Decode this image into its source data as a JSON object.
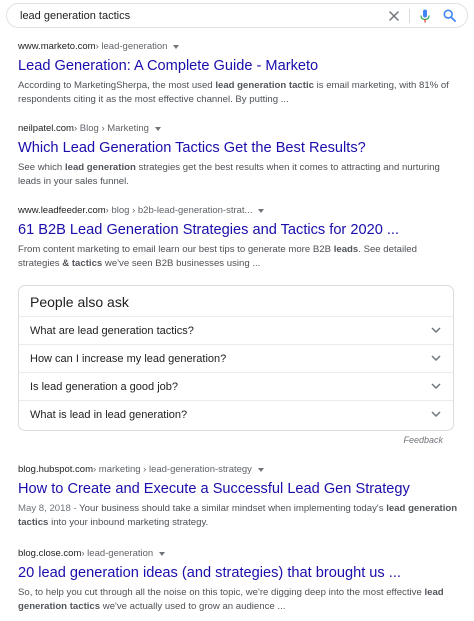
{
  "search": {
    "query": "lead generation tactics",
    "clear_icon": "close-icon",
    "voice_icon": "microphone-icon",
    "search_icon": "search-icon",
    "colors": {
      "mic_blue": "#4285f4",
      "mic_red": "#ea4335",
      "search_blue": "#4285f4"
    }
  },
  "results": [
    {
      "domain": "www.marketo.com",
      "path": " › lead-generation",
      "title": "Lead Generation: A Complete Guide - Marketo",
      "snippet": [
        {
          "t": "According to MarketingSherpa, the most used "
        },
        {
          "b": "lead generation tactic"
        },
        {
          "t": " is email marketing, with 81% of respondents citing it as the most effective channel. By putting ..."
        }
      ]
    },
    {
      "domain": "neilpatel.com",
      "path": " › Blog › Marketing",
      "title": "Which Lead Generation Tactics Get the Best Results?",
      "snippet": [
        {
          "t": "See which "
        },
        {
          "b": "lead generation"
        },
        {
          "t": " strategies get the best results when it comes to attracting and nurturing leads in your sales funnel."
        }
      ]
    },
    {
      "domain": "www.leadfeeder.com",
      "path": " › blog › b2b-lead-generation-strat...",
      "title": "61 B2B Lead Generation Strategies and Tactics for 2020 ...",
      "snippet": [
        {
          "t": "From content marketing to email learn our best tips to generate more B2B "
        },
        {
          "b": "leads"
        },
        {
          "t": ". See detailed strategies "
        },
        {
          "b": "& tactics"
        },
        {
          "t": " we've seen B2B businesses using ..."
        }
      ]
    },
    {
      "domain": "blog.hubspot.com",
      "path": " › marketing › lead-generation-strategy",
      "title": "How to Create and Execute a Successful Lead Gen Strategy",
      "date": "May 8, 2018 - ",
      "snippet": [
        {
          "t": "Your business should take a similar mindset when implementing today's "
        },
        {
          "b": "lead generation tactics"
        },
        {
          "t": " into your inbound marketing strategy."
        }
      ]
    },
    {
      "domain": "blog.close.com",
      "path": " › lead-generation",
      "title": "20 lead generation ideas (and strategies) that brought us ...",
      "snippet": [
        {
          "t": "So, to help you cut through all the noise on this topic, we're digging deep into the most effective "
        },
        {
          "b": "lead generation tactics"
        },
        {
          "t": " we've actually used to grow an audience ..."
        }
      ]
    }
  ],
  "people_also_ask": {
    "title": "People also ask",
    "questions": [
      "What are lead generation tactics?",
      "How can I increase my lead generation?",
      "Is lead generation a good job?",
      "What is lead in lead generation?"
    ],
    "expand_icon": "chevron-down-icon"
  },
  "feedback": "Feedback",
  "colors": {
    "link": "#1a0dab",
    "snippet": "#4d5156",
    "url": "#202124"
  }
}
